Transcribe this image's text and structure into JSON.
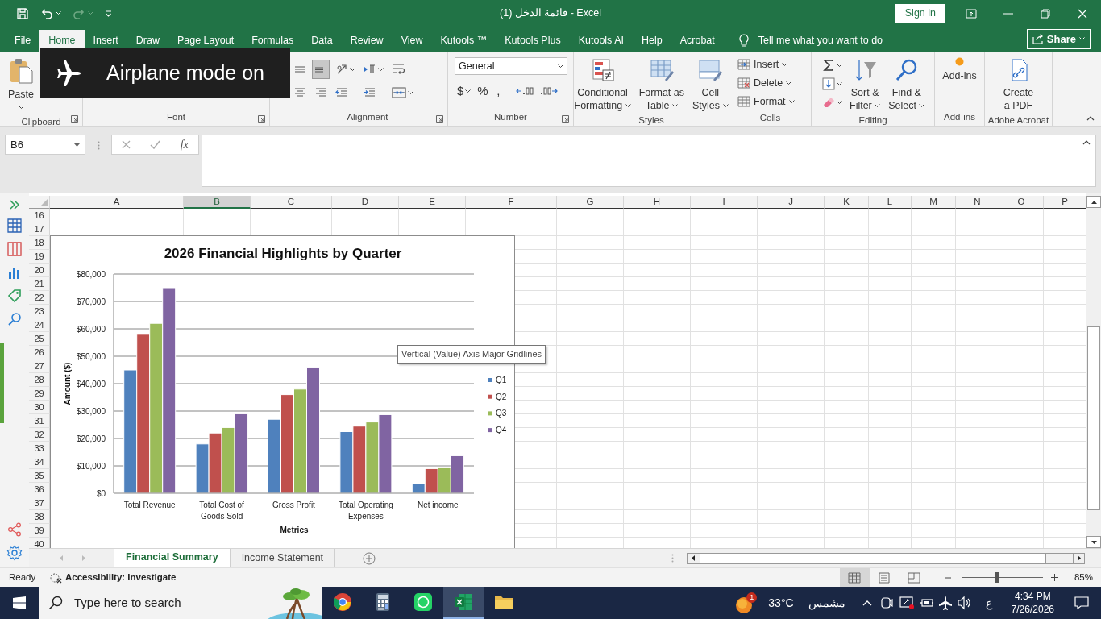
{
  "title_bar": {
    "title": "قائمة الدخل (1)  -  Excel",
    "sign_in": "Sign in"
  },
  "ribbon_tabs": [
    {
      "label": "File",
      "selected": false
    },
    {
      "label": "Home",
      "selected": true
    },
    {
      "label": "Insert",
      "selected": false
    },
    {
      "label": "Draw",
      "selected": false
    },
    {
      "label": "Page Layout",
      "selected": false
    },
    {
      "label": "Formulas",
      "selected": false
    },
    {
      "label": "Data",
      "selected": false
    },
    {
      "label": "Review",
      "selected": false
    },
    {
      "label": "View",
      "selected": false
    },
    {
      "label": "Kutools ™",
      "selected": false
    },
    {
      "label": "Kutools Plus",
      "selected": false
    },
    {
      "label": "Kutools AI",
      "selected": false
    },
    {
      "label": "Help",
      "selected": false
    },
    {
      "label": "Acrobat",
      "selected": false
    }
  ],
  "tell_me": "Tell me what you want to do",
  "share": "Share",
  "ribbon_groups": [
    {
      "label": "Clipboard",
      "launcher": true,
      "items": [
        {
          "kind": "large",
          "label": [
            "Paste"
          ],
          "dropdown": true
        }
      ]
    },
    {
      "label": "Font",
      "launcher": true
    },
    {
      "label": "Alignment",
      "launcher": true,
      "items": [
        {
          "kind": "tool",
          "on": false
        },
        {
          "kind": "tool",
          "on": false
        },
        {
          "kind": "tool",
          "on": true
        },
        {
          "kind": "tool",
          "on": false
        },
        {
          "kind": "tool",
          "on": false
        },
        {
          "kind": "tool",
          "on": false
        },
        {
          "kind": "tool",
          "on": false
        },
        {
          "kind": "tool",
          "on": false
        },
        {
          "kind": "tool",
          "on": false
        },
        {
          "kind": "tool",
          "on": false
        }
      ]
    },
    {
      "label": "Number",
      "launcher": true,
      "items": [
        {
          "kind": "format",
          "value": "General"
        },
        {
          "kind": "symbol",
          "label": "$",
          "dropdown": true
        },
        {
          "kind": "symbol",
          "label": "%",
          "dropdown": false
        },
        {
          "kind": "symbol",
          "label": ",",
          "dropdown": false
        },
        {
          "kind": "tool",
          "on": false
        },
        {
          "kind": "tool",
          "on": false
        }
      ]
    },
    {
      "label": "Styles",
      "items": [
        {
          "kind": "large",
          "label": [
            "Conditional",
            "Formatting"
          ],
          "dropdown": true
        },
        {
          "kind": "large",
          "label": [
            "Format as",
            "Table"
          ],
          "dropdown": true
        },
        {
          "kind": "large",
          "label": [
            "Cell",
            "Styles"
          ],
          "dropdown": true
        }
      ]
    },
    {
      "label": "Cells",
      "items": [
        {
          "kind": "small",
          "label": "Insert",
          "dropdown": true
        },
        {
          "kind": "small",
          "label": "Delete",
          "dropdown": true
        },
        {
          "kind": "small",
          "label": "Format",
          "dropdown": true
        }
      ]
    },
    {
      "label": "Editing",
      "items": [
        {
          "kind": "tool",
          "on": false
        },
        {
          "kind": "tool",
          "on": false
        },
        {
          "kind": "tool",
          "on": false
        },
        {
          "kind": "large",
          "label": [
            "Sort &",
            "Filter"
          ],
          "dropdown": true
        },
        {
          "kind": "large",
          "label": [
            "Find &",
            "Select"
          ],
          "dropdown": true
        }
      ]
    },
    {
      "label": "Add-ins",
      "items": [
        {
          "kind": "large",
          "label": [
            "Add-ins"
          ]
        }
      ]
    },
    {
      "label": "Adobe Acrobat",
      "items": [
        {
          "kind": "large",
          "label": [
            "Create",
            "a PDF"
          ]
        }
      ]
    }
  ],
  "formula_bar": {
    "name_box": "B6",
    "function_label": "fx"
  },
  "sheet": {
    "columns": [
      {
        "label": "A",
        "selected": false
      },
      {
        "label": "B",
        "selected": true
      },
      {
        "label": "C",
        "selected": false
      },
      {
        "label": "D",
        "selected": false
      },
      {
        "label": "E",
        "selected": false
      },
      {
        "label": "F",
        "selected": false
      },
      {
        "label": "G",
        "selected": false
      },
      {
        "label": "H",
        "selected": false
      },
      {
        "label": "I",
        "selected": false
      },
      {
        "label": "J",
        "selected": false
      },
      {
        "label": "K",
        "selected": false
      },
      {
        "label": "L",
        "selected": false
      },
      {
        "label": "M",
        "selected": false
      },
      {
        "label": "N",
        "selected": false
      },
      {
        "label": "O",
        "selected": false
      },
      {
        "label": "P",
        "selected": false
      }
    ],
    "rows": [
      "16",
      "17",
      "18",
      "19",
      "20",
      "21",
      "22",
      "23",
      "24",
      "25",
      "26",
      "27",
      "28",
      "29",
      "30",
      "31",
      "32",
      "33",
      "34",
      "35",
      "36",
      "37",
      "38",
      "39",
      "40"
    ]
  },
  "chart": {
    "tooltip": "Vertical (Value) Axis Major Gridlines",
    "chart_data": {
      "type": "bar",
      "title": "2026 Financial Highlights by Quarter",
      "xlabel": "Metrics",
      "ylabel": "Amount ($)",
      "categories": [
        "Total Revenue",
        "Total Cost of Goods Sold",
        "Gross Profit",
        "Total Operating Expenses",
        "Net income"
      ],
      "series": [
        {
          "name": "Q1",
          "color": "#4f81bd",
          "values": [
            45000,
            18000,
            27000,
            22500,
            3500
          ]
        },
        {
          "name": "Q2",
          "color": "#c0504d",
          "values": [
            58000,
            22000,
            36000,
            24500,
            9000
          ]
        },
        {
          "name": "Q3",
          "color": "#9bbb59",
          "values": [
            62000,
            24000,
            38000,
            26000,
            9300
          ]
        },
        {
          "name": "Q4",
          "color": "#8064a2",
          "values": [
            75000,
            29000,
            46000,
            28700,
            13700
          ]
        }
      ],
      "grid": true,
      "legend": true,
      "ylim": [
        0,
        80000
      ],
      "yticks": [
        {
          "value": 0,
          "label": "$0"
        },
        {
          "value": 10000,
          "label": "$10,000"
        },
        {
          "value": 20000,
          "label": "$20,000"
        },
        {
          "value": 30000,
          "label": "$30,000"
        },
        {
          "value": 40000,
          "label": "$40,000"
        },
        {
          "value": 50000,
          "label": "$50,000"
        },
        {
          "value": 60000,
          "label": "$60,000"
        },
        {
          "value": 70000,
          "label": "$70,000"
        },
        {
          "value": 80000,
          "label": "$80,000"
        }
      ]
    }
  },
  "sheet_tabs": [
    {
      "label": "Financial Summary",
      "selected": true
    },
    {
      "label": "Income Statement",
      "selected": false
    }
  ],
  "status_bar": {
    "status": "Ready",
    "accessibility": "Accessibility: Investigate",
    "views": [
      {
        "selected": true
      },
      {
        "selected": false
      },
      {
        "selected": false
      }
    ],
    "zoom_slider": {
      "level": 0.43
    },
    "zoom": "85%"
  },
  "taskbar": {
    "search": {
      "placeholder": "Type here to search"
    },
    "apps": [
      {
        "selected": false
      },
      {
        "selected": false
      },
      {
        "selected": false
      },
      {
        "selected": true
      },
      {
        "selected": false
      }
    ],
    "weather": {
      "badge": "1",
      "temperature": "33°C",
      "condition": "مشمس"
    },
    "language": "ع",
    "time": "4:34 PM",
    "date": "7/26/2026"
  },
  "toast": {
    "text": "Airplane mode on"
  }
}
